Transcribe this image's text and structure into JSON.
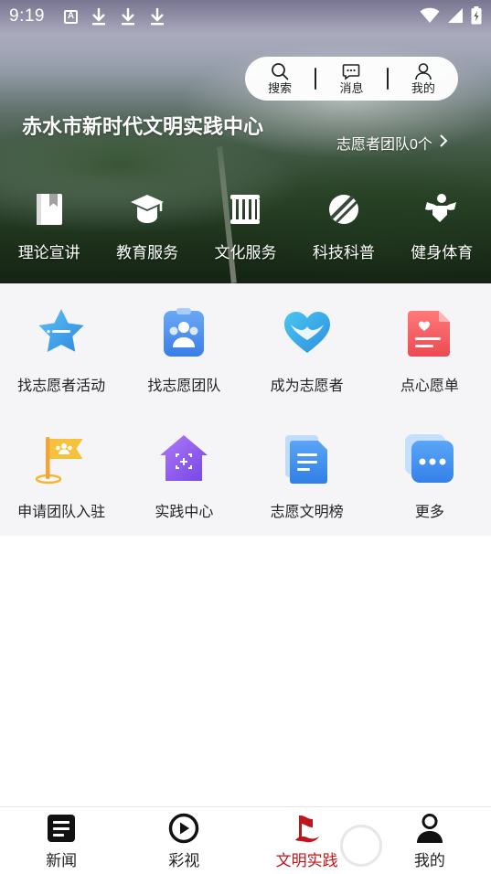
{
  "status_bar": {
    "time": "9:19",
    "badge_letter": "A",
    "icons": [
      "a-badge-icon",
      "download-icon",
      "download-icon",
      "download-icon",
      "wifi-icon",
      "signal-icon",
      "battery-charging-icon"
    ]
  },
  "top_actions": {
    "search_label": "搜索",
    "messages_label": "消息",
    "mine_label": "我的"
  },
  "hero": {
    "title": "赤水市新时代文明实践中心",
    "team_count_label": "志愿者团队0个"
  },
  "categories": [
    {
      "label": "理论宣讲",
      "icon": "book-icon"
    },
    {
      "label": "教育服务",
      "icon": "graduation-cap-icon"
    },
    {
      "label": "文化服务",
      "icon": "culture-icon"
    },
    {
      "label": "科技科普",
      "icon": "satellite-icon"
    },
    {
      "label": "健身体育",
      "icon": "fitness-icon"
    }
  ],
  "services": [
    {
      "label": "找志愿者活动",
      "icon": "star-chat-icon",
      "color": "#3aa1e8"
    },
    {
      "label": "找志愿团队",
      "icon": "team-clipboard-icon",
      "color": "#4a8fe8"
    },
    {
      "label": "成为志愿者",
      "icon": "heart-icon",
      "color": "#3fb4e8"
    },
    {
      "label": "点心愿单",
      "icon": "wish-list-icon",
      "color": "#f0555b"
    },
    {
      "label": "申请团队入驻",
      "icon": "flag-icon",
      "color": "#f5b731"
    },
    {
      "label": "实践中心",
      "icon": "house-icon",
      "color": "#8a5cf0"
    },
    {
      "label": "志愿文明榜",
      "icon": "document-icon",
      "color": "#3f8ee8"
    },
    {
      "label": "更多",
      "icon": "more-icon",
      "color": "#3f8ee8"
    }
  ],
  "bottom_nav": [
    {
      "label": "新闻",
      "icon": "news-icon",
      "active": false
    },
    {
      "label": "彩视",
      "icon": "play-icon",
      "active": false
    },
    {
      "label": "文明实践",
      "icon": "civilization-flag-icon",
      "active": true
    },
    {
      "label": "我的",
      "icon": "user-icon",
      "active": false
    }
  ],
  "colors": {
    "accent_active": "#c0161b",
    "grid_background": "#f5f5f7"
  }
}
